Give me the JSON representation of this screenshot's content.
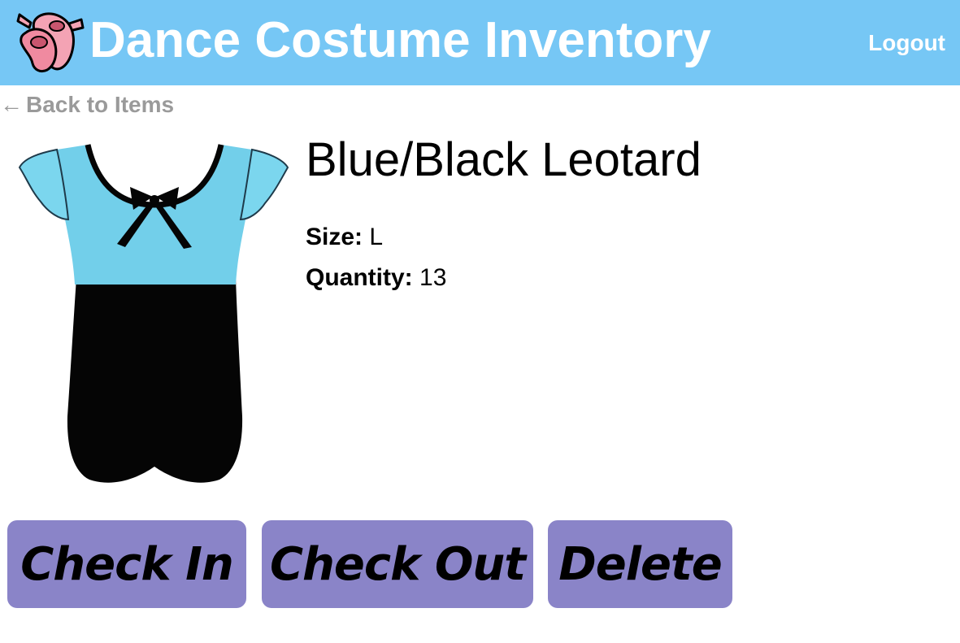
{
  "header": {
    "title": "Dance Costume Inventory",
    "logout_label": "Logout",
    "icon": "ballet-shoes-icon",
    "background_color": "#76c7f5"
  },
  "nav": {
    "back_arrow": "←",
    "back_label": "Back to Items"
  },
  "item": {
    "name": "Blue/Black Leotard",
    "image_icon": "leotard-image",
    "size_label": "Size:",
    "size_value": "L",
    "quantity_label": "Quantity:",
    "quantity_value": "13"
  },
  "actions": {
    "check_in_label": "Check In",
    "check_out_label": "Check Out",
    "delete_label": "Delete",
    "button_color": "#8a84c8"
  }
}
